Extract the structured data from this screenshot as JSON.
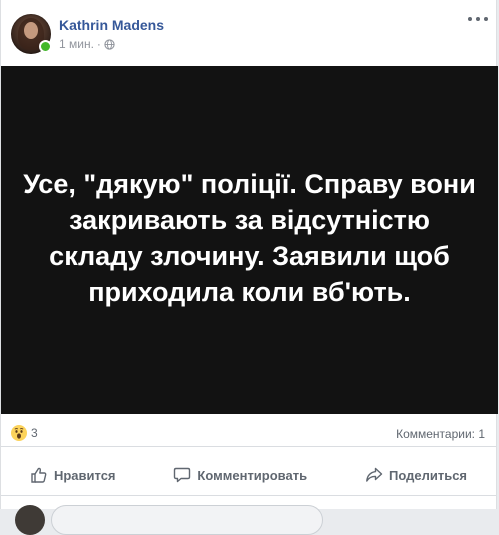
{
  "post": {
    "author": "Kathrin Madens",
    "time": "1 мин.",
    "separator": "·",
    "text": "Усе, \"дякую\" поліції. Справу вони закривають за відсутністю складу злочину. Заявили щоб приходила коли вб'ють."
  },
  "stats": {
    "reaction_count": "3",
    "comments": "Комментарии: 1"
  },
  "actions": {
    "like": "Нравится",
    "comment": "Комментировать",
    "share": "Поделиться"
  },
  "colors": {
    "author": "#365899",
    "image_bg": "#121212",
    "online": "#42b72a"
  },
  "icons": [
    "globe-icon",
    "more-options-icon",
    "wow-reaction-icon",
    "like-icon",
    "comment-icon",
    "share-icon"
  ]
}
